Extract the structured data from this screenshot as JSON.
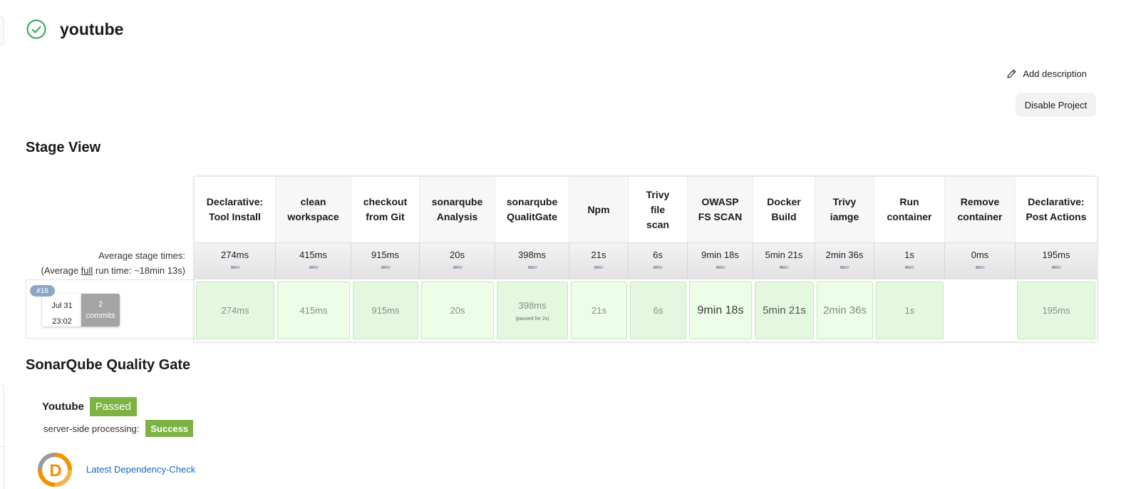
{
  "header": {
    "title": "youtube",
    "status": "success",
    "status_icon": "check-circle-icon",
    "status_color": "#2ea44f"
  },
  "actions": {
    "add_description": "Add description",
    "disable_project": "Disable Project"
  },
  "stage_view": {
    "title": "Stage View",
    "avg_stage_times_label": "Average stage times:",
    "avg_run_prefix": "(Average ",
    "avg_run_link": "full",
    "avg_run_suffix": " run time: ~18min 13s)",
    "build": {
      "number": "#16",
      "date": "Jul 31",
      "time": "23:02",
      "commits_count": "2",
      "commits_label": "commits"
    },
    "stages": [
      {
        "name": "Declarative: Tool Install",
        "avg": "274ms",
        "run": "274ms",
        "paused": "",
        "status": "success"
      },
      {
        "name": "clean workspace",
        "avg": "415ms",
        "run": "415ms",
        "paused": "",
        "status": "success"
      },
      {
        "name": "checkout from Git",
        "avg": "915ms",
        "run": "915ms",
        "paused": "",
        "status": "success"
      },
      {
        "name": "sonarqube Analysis",
        "avg": "20s",
        "run": "20s",
        "paused": "",
        "status": "success"
      },
      {
        "name": "sonarqube QualitGate",
        "avg": "398ms",
        "run": "398ms",
        "paused": "(paused for 2s)",
        "status": "success"
      },
      {
        "name": "Npm",
        "avg": "21s",
        "run": "21s",
        "paused": "",
        "status": "success"
      },
      {
        "name": "Trivy file scan",
        "avg": "6s",
        "run": "6s",
        "paused": "",
        "status": "success"
      },
      {
        "name": "OWASP FS SCAN",
        "avg": "9min 18s",
        "run": "9min 18s",
        "paused": "",
        "status": "success"
      },
      {
        "name": "Docker Build",
        "avg": "5min 21s",
        "run": "5min 21s",
        "paused": "",
        "status": "success"
      },
      {
        "name": "Trivy iamge",
        "avg": "2min 36s",
        "run": "2min 36s",
        "paused": "",
        "status": "success"
      },
      {
        "name": "Run container",
        "avg": "1s",
        "run": "1s",
        "paused": "",
        "status": "success"
      },
      {
        "name": "Remove container",
        "avg": "0ms",
        "run": "",
        "paused": "",
        "status": "empty"
      },
      {
        "name": "Declarative: Post Actions",
        "avg": "195ms",
        "run": "195ms",
        "paused": "",
        "status": "success"
      }
    ]
  },
  "sonarqube": {
    "title": "SonarQube Quality Gate",
    "project": "Youtube",
    "status": "Passed",
    "server_side_label": "server-side processing:",
    "server_side_status": "Success",
    "badge_color": "#7cb342"
  },
  "dependency_check": {
    "icon": "dependency-check-icon",
    "link": "Latest Dependency-Check"
  }
}
